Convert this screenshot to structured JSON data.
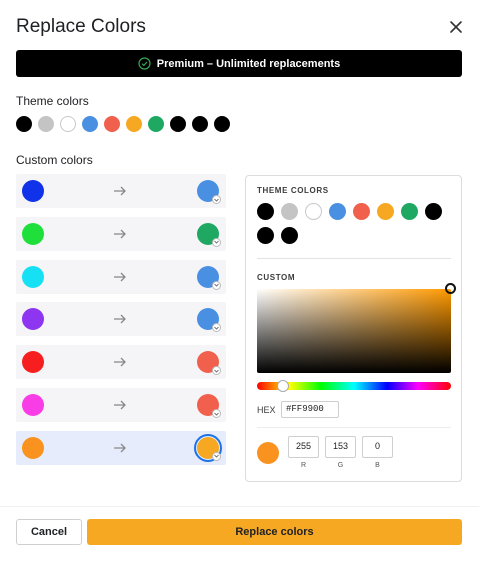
{
  "dialog": {
    "title": "Replace Colors"
  },
  "premium_banner": {
    "text": "Premium – Unlimited replacements",
    "check_color": "#34a853"
  },
  "theme": {
    "label": "Theme colors",
    "colors": [
      "#000000",
      "#c4c4c4",
      "#ffffff",
      "#4a90e2",
      "#f0604d",
      "#f7a823",
      "#1fa862",
      "#000000",
      "#000000",
      "#000000"
    ]
  },
  "custom": {
    "label": "Custom colors",
    "mappings": [
      {
        "from": "#1032e8",
        "to": "#4a90e2",
        "selected": false
      },
      {
        "from": "#1fe03a",
        "to": "#1fa862",
        "selected": false
      },
      {
        "from": "#16e0f4",
        "to": "#4a90e2",
        "selected": false
      },
      {
        "from": "#8d35f0",
        "to": "#4a90e2",
        "selected": false
      },
      {
        "from": "#f61e1e",
        "to": "#f0604d",
        "selected": false
      },
      {
        "from": "#f93de6",
        "to": "#f0604d",
        "selected": false
      },
      {
        "from": "#f9921f",
        "to": "#f7a823",
        "selected": true
      }
    ]
  },
  "picker": {
    "theme_label": "THEME COLORS",
    "theme_colors": [
      "#000000",
      "#c4c4c4",
      "#ffffff",
      "#4a90e2",
      "#f0604d",
      "#f7a823",
      "#1fa862",
      "#000000",
      "#000000",
      "#000000"
    ],
    "custom_label": "CUSTOM",
    "hex_label": "HEX",
    "hex_value": "#FF9900",
    "swatch": "#f9921f",
    "r": "255",
    "g": "153",
    "b": "0",
    "r_label": "R",
    "g_label": "G",
    "b_label": "B"
  },
  "footer": {
    "cancel_label": "Cancel",
    "replace_label": "Replace colors"
  }
}
